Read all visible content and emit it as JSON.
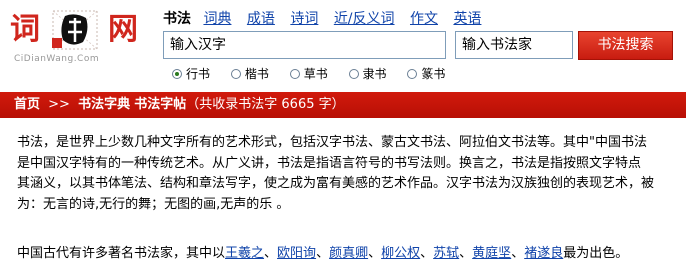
{
  "logo": {
    "char_left": "词",
    "char_right": "网",
    "domain": "CiDianWang.Com",
    "seal_text": "典"
  },
  "nav": {
    "current": "书法",
    "links": [
      "词典",
      "成语",
      "诗词",
      "近/反义词",
      "作文",
      "英语"
    ]
  },
  "search": {
    "value": "输入汉字",
    "artist_value": "输入书法家",
    "button_label": "书法搜索"
  },
  "script_styles": {
    "options": [
      "行书",
      "楷书",
      "草书",
      "隶书",
      "篆书"
    ],
    "selected": "行书"
  },
  "breadcrumb": {
    "home": "首页",
    "separator": ">>",
    "section": "书法字典",
    "page": "书法字帖",
    "count_text": "（共收录书法字 6665 字）"
  },
  "intro": {
    "lines": [
      "书法，是世界上少数几种文字所有的艺术形式，包括汉字书法、蒙古文书法、阿拉伯文书法等。其中\"中国书法",
      "是中国汉字特有的一种传统艺术。从广义讲，书法是指语言符号的书写法则。换言之，书法是指按照文字特点",
      "其涵义，以其书体笔法、结构和章法写字，使之成为富有美感的艺术作品。汉字书法为汉族独创的表现艺术，被",
      "为：无言的诗,无行的舞；无图的画,无声的乐 。"
    ]
  },
  "calligraphers": {
    "lead": "中国古代有许多著名书法家，其中以",
    "names": [
      "王羲之",
      "欧阳询",
      "颜真卿",
      "柳公权",
      "苏轼",
      "黄庭坚",
      "褚遂良"
    ],
    "tail": "最为出色。"
  },
  "colors": {
    "brand_red": "#d0261d",
    "link_blue": "#1144aa"
  }
}
